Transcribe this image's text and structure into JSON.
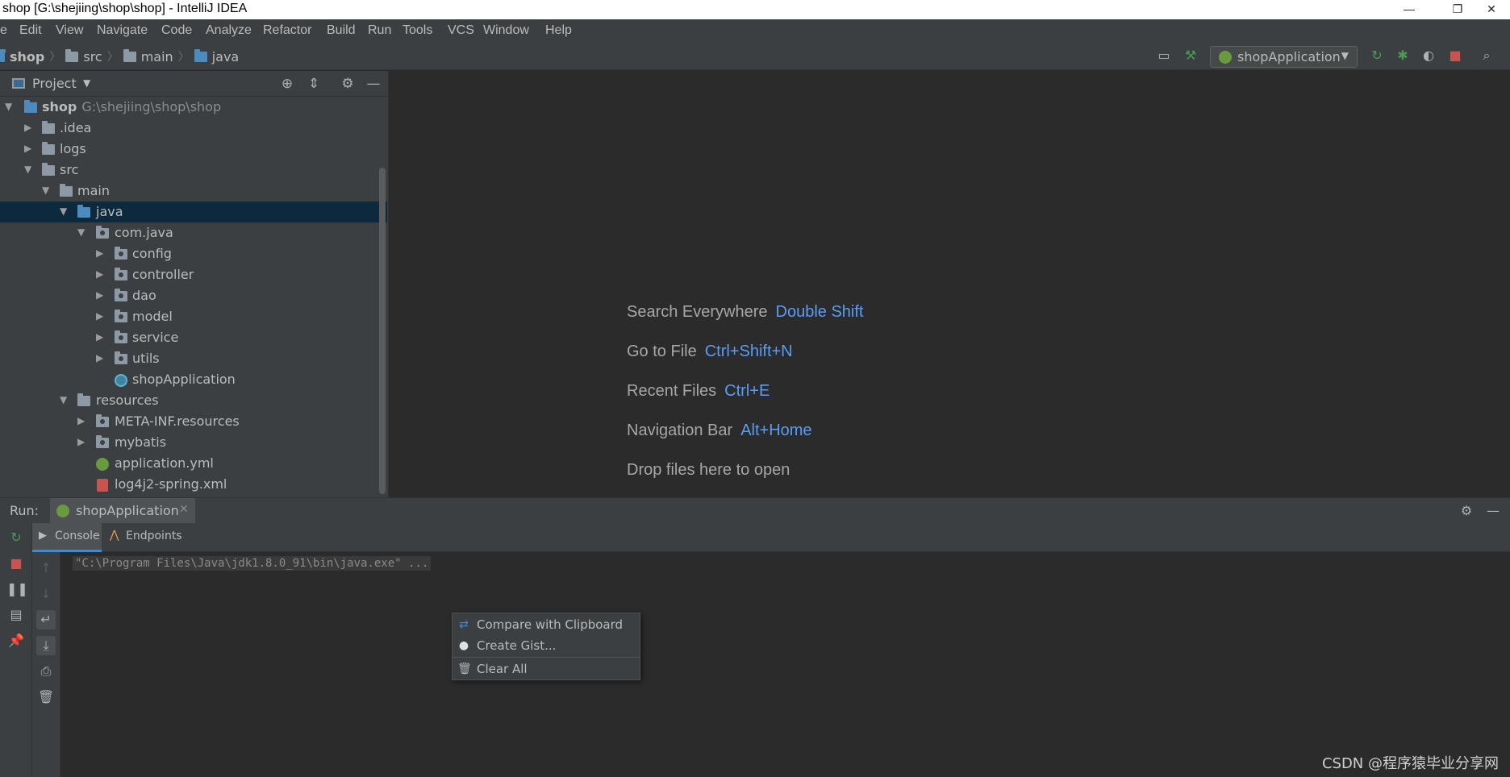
{
  "window": {
    "title": "shop [G:\\shejiing\\shop\\shop] - IntelliJ IDEA",
    "minimize": "—",
    "maximize": "❐",
    "close": "✕"
  },
  "menu": [
    "e",
    "Edit",
    "View",
    "Navigate",
    "Code",
    "Analyze",
    "Refactor",
    "Build",
    "Run",
    "Tools",
    "VCS",
    "Window",
    "Help"
  ],
  "breadcrumb": [
    "shop",
    "src",
    "main",
    "java"
  ],
  "toolbar": {
    "run_config": "shopApplication"
  },
  "project": {
    "title": "Project",
    "tree": [
      {
        "label": "shop",
        "path": "G:\\shejiing\\shop\\shop"
      },
      {
        "label": ".idea"
      },
      {
        "label": "logs"
      },
      {
        "label": "src"
      },
      {
        "label": "main"
      },
      {
        "label": "java"
      },
      {
        "label": "com.java"
      },
      {
        "label": "config"
      },
      {
        "label": "controller"
      },
      {
        "label": "dao"
      },
      {
        "label": "model"
      },
      {
        "label": "service"
      },
      {
        "label": "utils"
      },
      {
        "label": "shopApplication"
      },
      {
        "label": "resources"
      },
      {
        "label": "META-INF.resources"
      },
      {
        "label": "mybatis"
      },
      {
        "label": "application.yml"
      },
      {
        "label": "log4j2-spring.xml"
      }
    ]
  },
  "editor_hints": [
    {
      "label": "Search Everywhere",
      "key": "Double Shift"
    },
    {
      "label": "Go to File",
      "key": "Ctrl+Shift+N"
    },
    {
      "label": "Recent Files",
      "key": "Ctrl+E"
    },
    {
      "label": "Navigation Bar",
      "key": "Alt+Home"
    },
    {
      "label": "Drop files here to open",
      "key": ""
    }
  ],
  "run_panel": {
    "label": "Run:",
    "tab": "shopApplication",
    "console_tabs": [
      "Console",
      "Endpoints"
    ],
    "command": "\"C:\\Program Files\\Java\\jdk1.8.0_91\\bin\\java.exe\" ..."
  },
  "context_menu": [
    "Compare with Clipboard",
    "Create Gist...",
    "Clear All"
  ],
  "watermark": "CSDN @程序猿毕业分享网",
  "colors": {
    "accent": "#4a88c7",
    "key": "#589df6",
    "run": "#499c54",
    "stop": "#c75450"
  }
}
